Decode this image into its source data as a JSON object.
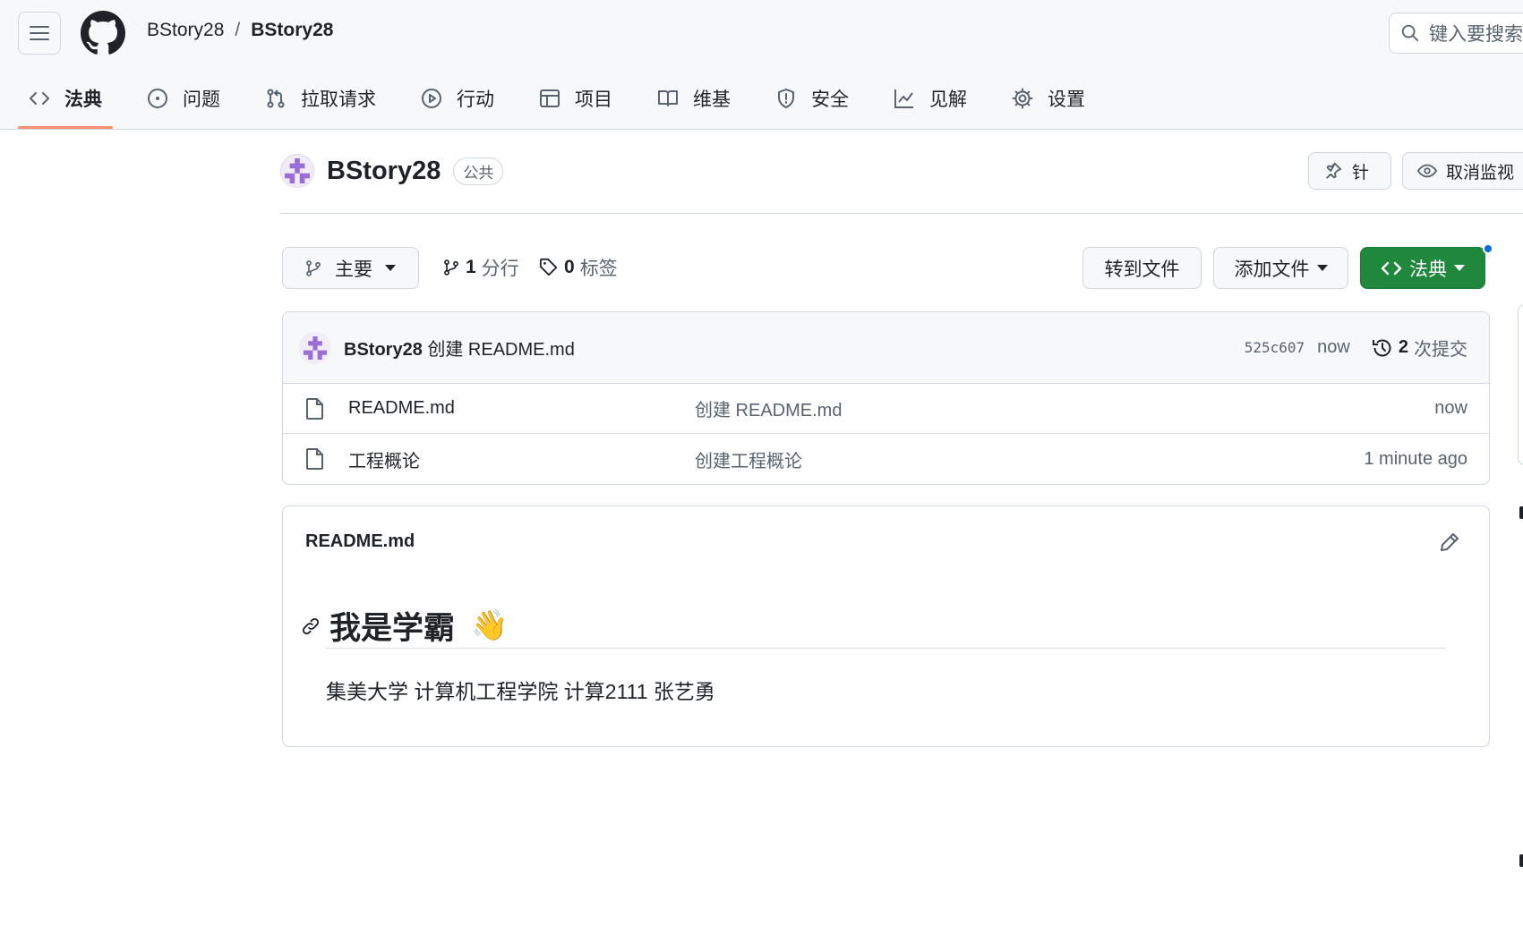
{
  "breadcrumb": {
    "owner": "BStory28",
    "separator": "/",
    "repo": "BStory28"
  },
  "search": {
    "placeholder": "键入要搜索"
  },
  "tabs": [
    {
      "label": "法典",
      "icon": "code-icon",
      "active": true
    },
    {
      "label": "问题",
      "icon": "issue-icon"
    },
    {
      "label": "拉取请求",
      "icon": "pull-request-icon"
    },
    {
      "label": "行动",
      "icon": "play-icon"
    },
    {
      "label": "项目",
      "icon": "table-icon"
    },
    {
      "label": "维基",
      "icon": "book-icon"
    },
    {
      "label": "安全",
      "icon": "shield-icon"
    },
    {
      "label": "见解",
      "icon": "graph-icon"
    },
    {
      "label": "设置",
      "icon": "gear-icon"
    }
  ],
  "repo": {
    "name": "BStory28",
    "visibility": "公共",
    "pin_label": "针",
    "watch_label": "取消监视"
  },
  "branch_bar": {
    "branch": "主要",
    "branch_count": "1",
    "branch_label": "分行",
    "tag_count": "0",
    "tag_label": "标签",
    "goto_file": "转到文件",
    "add_file": "添加文件",
    "code": "法典"
  },
  "latest_commit": {
    "author": "BStory28",
    "message": "创建 README.md",
    "hash": "525c607",
    "time": "now",
    "commit_count": "2",
    "commit_label": "次提交"
  },
  "files": [
    {
      "name": "README.md",
      "message": "创建 README.md",
      "time": "now"
    },
    {
      "name": "工程概论",
      "message": "创建工程概论",
      "time": "1 minute ago"
    }
  ],
  "readme": {
    "title": "README.md",
    "heading": "我是学霸",
    "emoji": "👋",
    "paragraph": "集美大学 计算机工程学院 计算2111 张艺勇"
  },
  "colors": {
    "accent_tab": "#fd8c73",
    "green": "#1f883d",
    "border": "#d0d7de",
    "muted": "#59636e"
  }
}
